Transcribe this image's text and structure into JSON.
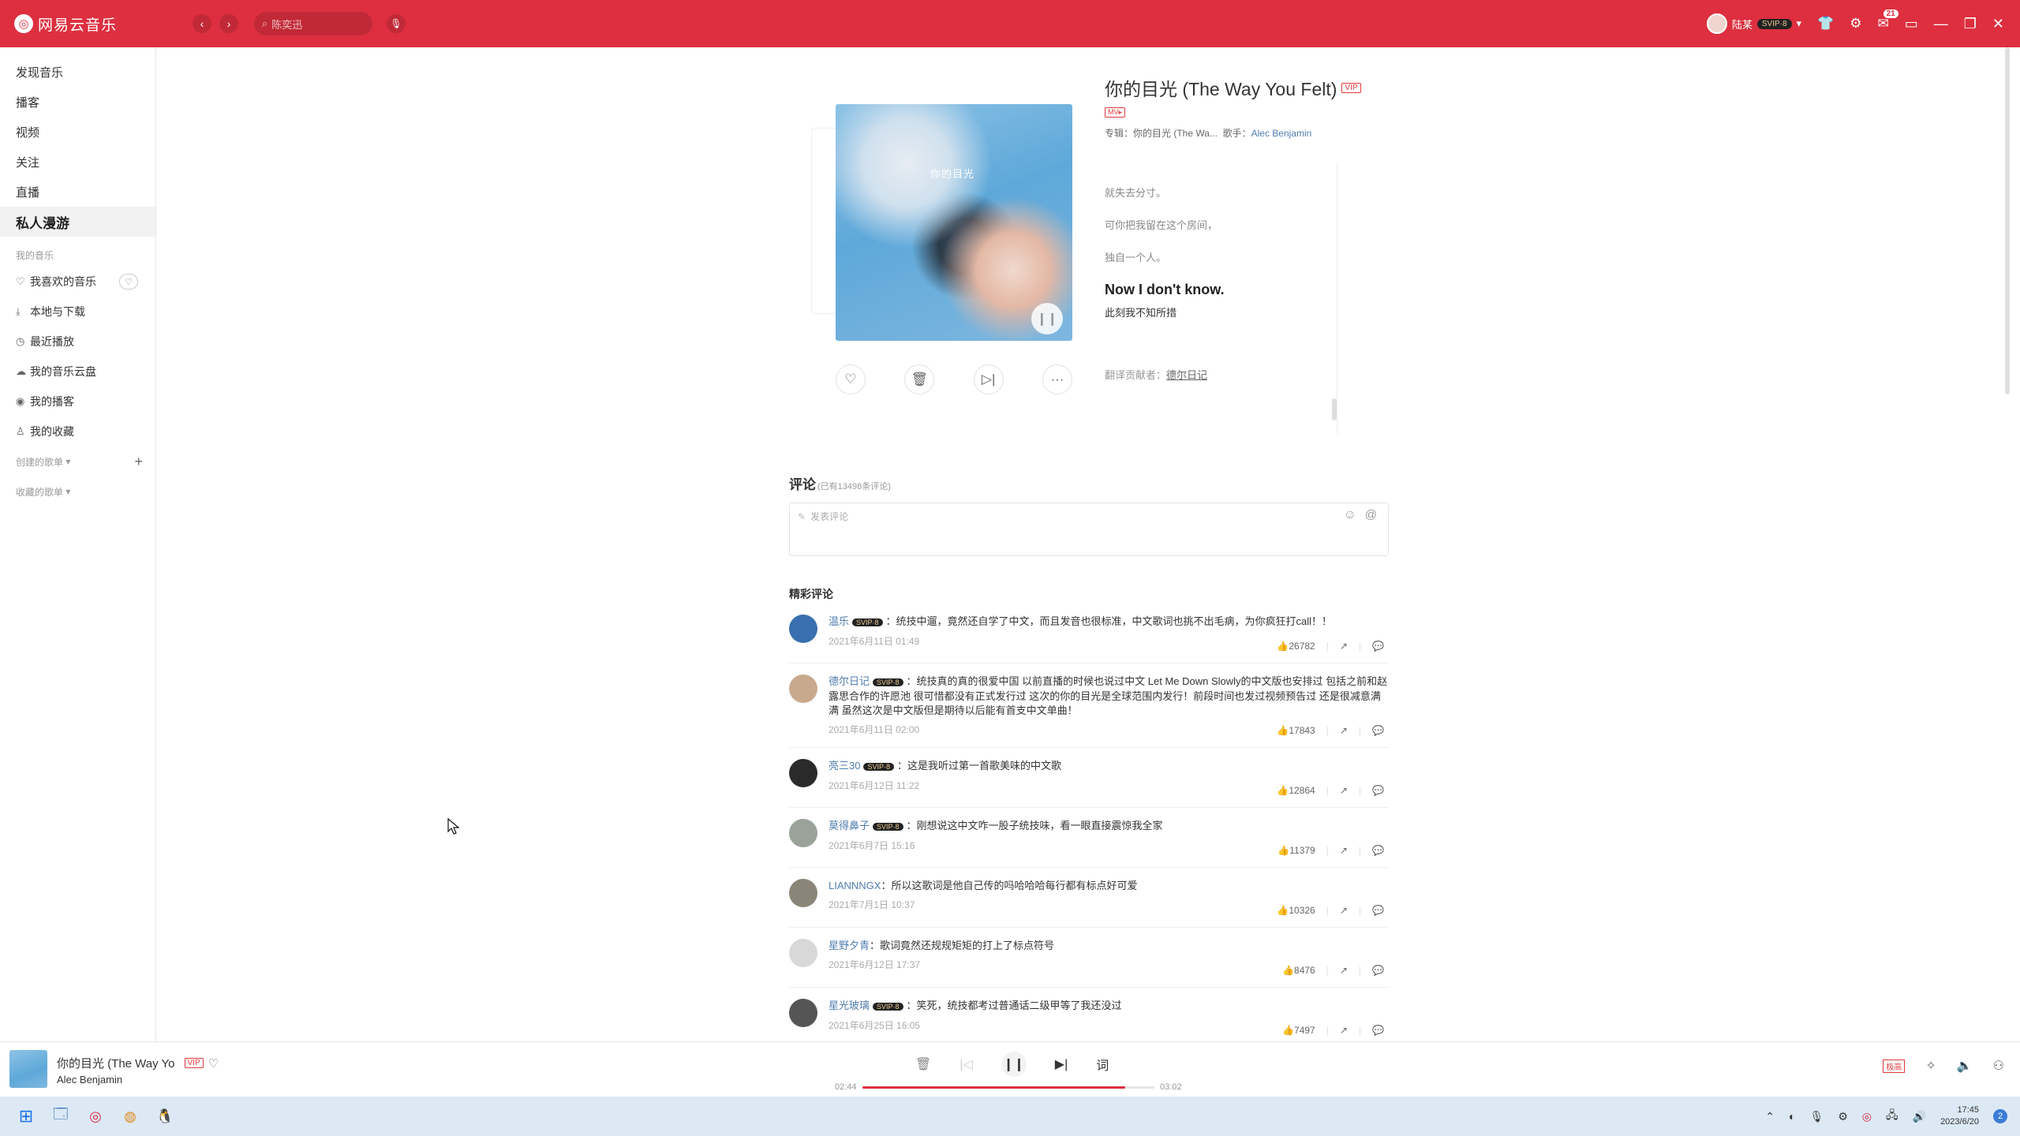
{
  "titlebar": {
    "brand": "网易云音乐",
    "search_placeholder": "陈奕迅",
    "user_name": "陆某",
    "user_vip": "SVIP·8",
    "mail_badge": "21"
  },
  "sidebar": {
    "nav": [
      "发现音乐",
      "播客",
      "视频",
      "关注",
      "直播",
      "私人漫游"
    ],
    "my_music_label": "我的音乐",
    "my_music": [
      {
        "label": "我喜欢的音乐",
        "icon": "heart-icon"
      },
      {
        "label": "本地与下载",
        "icon": "download-icon"
      },
      {
        "label": "最近播放",
        "icon": "clock-icon"
      },
      {
        "label": "我的音乐云盘",
        "icon": "cloud-icon"
      },
      {
        "label": "我的播客",
        "icon": "podcast-icon"
      },
      {
        "label": "我的收藏",
        "icon": "collection-icon"
      }
    ],
    "created_playlists": "创建的歌单",
    "collected_playlists": "收藏的歌单"
  },
  "song": {
    "title": "你的目光 (The Way You Felt)",
    "vip_tag": "VIP",
    "mv_tag": "MV▸",
    "album_label": "专辑：",
    "album": "你的目光 (The Wa...",
    "artist_label": "歌手：",
    "artist": "Alec Benjamin",
    "cover_text": "你的目光"
  },
  "lyrics": {
    "lines": [
      "就失去分寸。",
      "可你把我留在这个房间，",
      "独自一个人。"
    ],
    "active_en": "Now I don't know.",
    "active_cn": "此刻我不知所措",
    "translator_label": "翻译贡献者：",
    "translator": "德尔日记"
  },
  "comments": {
    "title": "评论",
    "count": "(已有13498条评论)",
    "input_placeholder": "发表评论",
    "section": "精彩评论",
    "items": [
      {
        "user": "温乐",
        "vip": "SVIP·8",
        "text": "：统技中遛，竟然还自学了中文，而且发音也很标准，中文歌词也挑不出毛病，为你疯狂打call！！",
        "time": "2021年6月11日 01:49",
        "likes": "26782",
        "avatar": "#3a6fb0"
      },
      {
        "user": "德尔日记",
        "vip": "SVIP·8",
        "text": "：统技真的真的很爱中国 以前直播的时候也说过中文 Let Me Down Slowly的中文版也安排过 包括之前和赵露思合作的许愿池 很可惜都没有正式发行过 这次的你的目光是全球范围内发行！前段时间也发过视频预告过 还是很减意满满 虽然这次是中文版但是期待以后能有首支中文单曲！",
        "time": "2021年6月11日 02:00",
        "likes": "17843",
        "avatar": "#c9a98e"
      },
      {
        "user": "亮三30",
        "vip": "SVIP·8",
        "text": "：这是我听过第一首歌美味的中文歌",
        "time": "2021年6月12日 11:22",
        "likes": "12864",
        "avatar": "#2b2b2b"
      },
      {
        "user": "莫得鼻子",
        "vip": "SVIP·8",
        "text": "：刚想说这中文咋一股子统技味，看一眼直接震惊我全家",
        "time": "2021年6月7日 15:16",
        "likes": "11379",
        "avatar": "#9aa39a"
      },
      {
        "user": "LIANNNGX",
        "vip": "",
        "text": "：所以这歌词是他自己传的吗哈哈哈每行都有标点好可爱",
        "time": "2021年7月1日 10:37",
        "likes": "10326",
        "avatar": "#8b8579"
      },
      {
        "user": "星野夕青",
        "vip": "",
        "text": "：歌词竟然还规规矩矩的打上了标点符号",
        "time": "2021年6月12日 17:37",
        "likes": "8476",
        "avatar": "#d8d8d8"
      },
      {
        "user": "星光玻璃",
        "vip": "SVIP·8",
        "text": "：笑死，统技都考过普通话二级甲等了我还没过",
        "time": "2021年6月25日 16:05",
        "likes": "7497",
        "avatar": "#555555"
      }
    ]
  },
  "player": {
    "title": "你的目光 (The Way Yo",
    "vip_tag": "VIP",
    "artist": "Alec Benjamin",
    "current_time": "02:44",
    "total_time": "03:02",
    "progress": 0.9,
    "lyric_btn": "词",
    "quality_tag": "极高"
  },
  "taskbar": {
    "time": "17:45",
    "date": "2023/6/20",
    "notifications": "2"
  },
  "colors": {
    "accent": "#dd2f3f",
    "link": "#507daf"
  }
}
